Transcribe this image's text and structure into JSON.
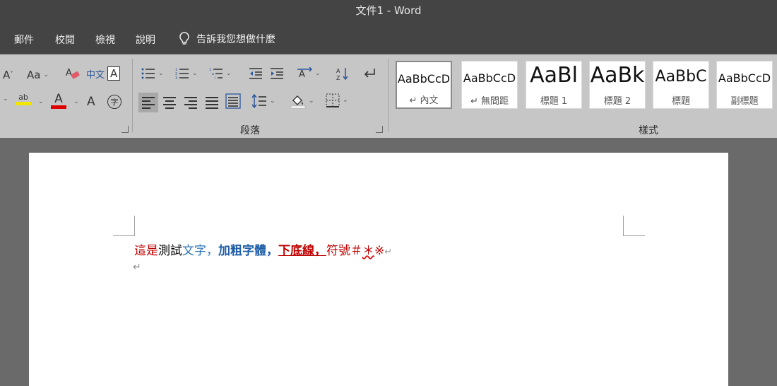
{
  "window": {
    "title": "文件1  -  Word"
  },
  "menu": {
    "tabs": [
      "郵件",
      "校閱",
      "檢視",
      "說明"
    ],
    "tell_me": "告訴我您想做什麼"
  },
  "ribbon": {
    "paragraph_group": "段落",
    "styles_group": "樣式",
    "styles": [
      {
        "sample": "AaBbCcD",
        "name": "↵ 內文"
      },
      {
        "sample": "AaBbCcD",
        "name": "↵ 無間距"
      },
      {
        "sample": "AaBl",
        "name": "標題 1"
      },
      {
        "sample": "AaBk",
        "name": "標題 2"
      },
      {
        "sample": "AaBbC",
        "name": "標題"
      },
      {
        "sample": "AaBbCcD",
        "name": "副標題"
      }
    ],
    "font_labels": {
      "grow": "A",
      "case": "Aa",
      "phonetic": "中文",
      "box": "A",
      "highlight": "ab",
      "color": "A",
      "shade": "A",
      "circle": "字"
    },
    "colors": {
      "highlight": "#f2e600",
      "font_color": "#e00000",
      "accent": "#2b579a"
    }
  },
  "document": {
    "runs": [
      {
        "text": "這是",
        "color": "#c00000",
        "bold": false,
        "underline": false
      },
      {
        "text": "測試",
        "color": "#000000",
        "bold": false,
        "underline": false
      },
      {
        "text": "文字，",
        "color": "#2e75b6",
        "bold": false,
        "underline": false
      },
      {
        "text": "加粗字體，",
        "color": "#1f5ea8",
        "bold": true,
        "underline": false
      },
      {
        "text": "下底線，",
        "color": "#c00000",
        "bold": true,
        "underline": true
      },
      {
        "text": "符號＃",
        "color": "#c00000",
        "bold": false,
        "underline": false
      },
      {
        "text": "＊",
        "color": "#c00000",
        "bold": false,
        "underline": false,
        "squiggle": true
      },
      {
        "text": "※",
        "color": "#c00000",
        "bold": false,
        "underline": false
      },
      {
        "text": "↵",
        "color": "#999999",
        "bold": false,
        "underline": false
      }
    ],
    "empty_paragraph_mark": "↵"
  }
}
